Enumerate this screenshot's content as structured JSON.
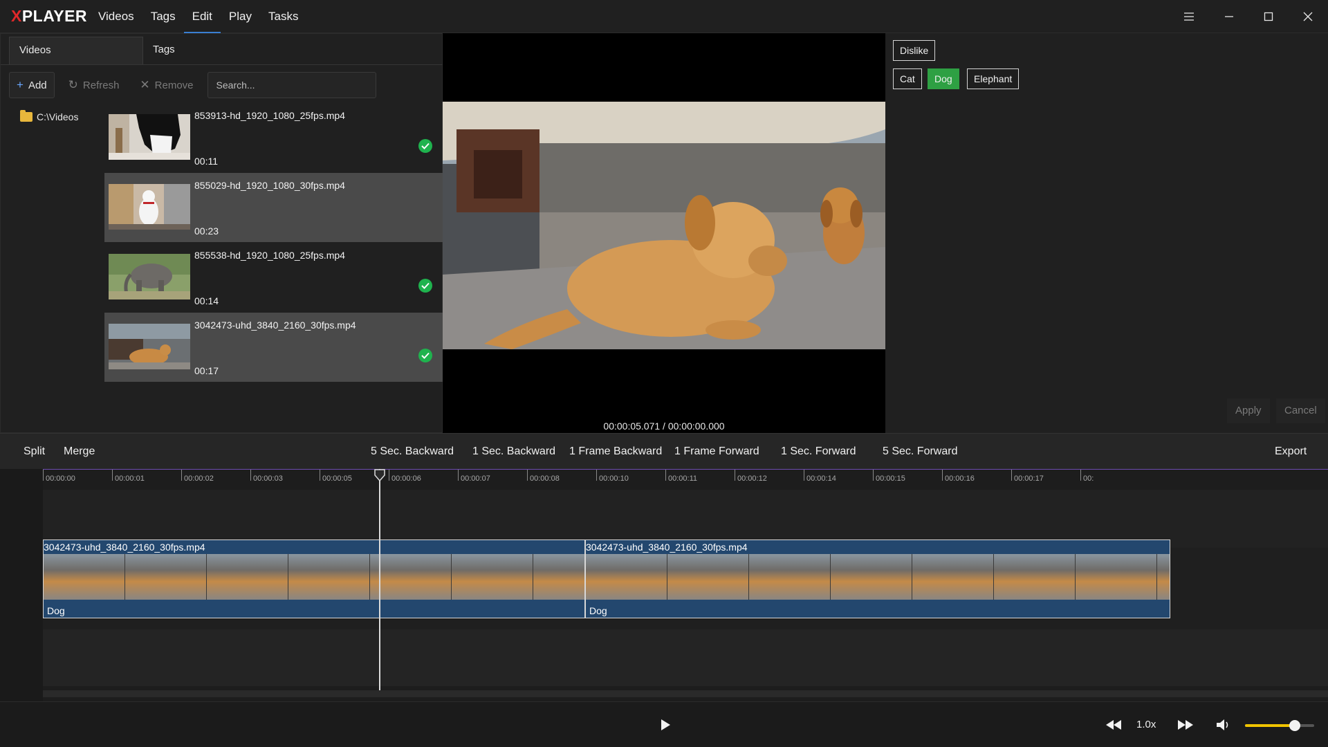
{
  "app": {
    "logo_x": "X",
    "logo_rest": "PLAYER"
  },
  "menu": [
    "Videos",
    "Tags",
    "Edit",
    "Play",
    "Tasks"
  ],
  "menu_active": "Edit",
  "left_panel": {
    "tabs": [
      "Videos",
      "Tags"
    ],
    "toolbar": {
      "add": "Add",
      "refresh": "Refresh",
      "remove": "Remove"
    },
    "search_placeholder": "Search...",
    "folder": "C:\\Videos",
    "videos": [
      {
        "name": "853913-hd_1920_1080_25fps.mp4",
        "duration": "00:11",
        "tagged": true,
        "selected": false
      },
      {
        "name": "855029-hd_1920_1080_30fps.mp4",
        "duration": "00:23",
        "tagged": false,
        "selected": true
      },
      {
        "name": "855538-hd_1920_1080_25fps.mp4",
        "duration": "00:14",
        "tagged": true,
        "selected": false
      },
      {
        "name": "3042473-uhd_3840_2160_30fps.mp4",
        "duration": "00:17",
        "tagged": true,
        "selected": true
      }
    ]
  },
  "preview": {
    "timecode": "00:00:05.071 / 00:00:00.000"
  },
  "tags": {
    "dislike": "Dislike",
    "items": [
      {
        "label": "Cat",
        "active": false
      },
      {
        "label": "Dog",
        "active": true
      },
      {
        "label": "Elephant",
        "active": false
      }
    ],
    "apply": "Apply",
    "cancel": "Cancel"
  },
  "controls": {
    "split": "Split",
    "merge": "Merge",
    "nav": [
      "5 Sec. Backward",
      "1 Sec. Backward",
      "1 Frame Backward",
      "1 Frame Forward",
      "1 Sec. Forward",
      "5 Sec. Forward"
    ],
    "export": "Export"
  },
  "timeline": {
    "ticks": [
      "00:00:00",
      "00:00:01",
      "00:00:02",
      "00:00:03",
      "00:00:05",
      "00:00:06",
      "00:00:07",
      "00:00:08",
      "00:00:10",
      "00:00:11",
      "00:00:12",
      "00:00:14",
      "00:00:15",
      "00:00:16",
      "00:00:17",
      "00:"
    ],
    "clips": [
      {
        "name": "3042473-uhd_3840_2160_30fps.mp4",
        "tag": "Dog"
      },
      {
        "name": "3042473-uhd_3840_2160_30fps.mp4",
        "tag": "Dog"
      }
    ]
  },
  "transport": {
    "speed": "1.0x",
    "volume": 0.72
  },
  "colors": {
    "accent_tab": "#3a7fd2",
    "tag_active": "#2ea043",
    "check": "#1fb34e",
    "clip": "#23476e",
    "volume": "#f0c400",
    "logo_x": "#e0282a"
  },
  "icons": [
    "hamburger-icon",
    "minimize-icon",
    "maximize-icon",
    "close-icon",
    "plus-icon",
    "refresh-icon",
    "x-icon",
    "folder-icon",
    "check-icon",
    "play-icon",
    "rewind-icon",
    "fast-forward-icon",
    "volume-icon"
  ]
}
